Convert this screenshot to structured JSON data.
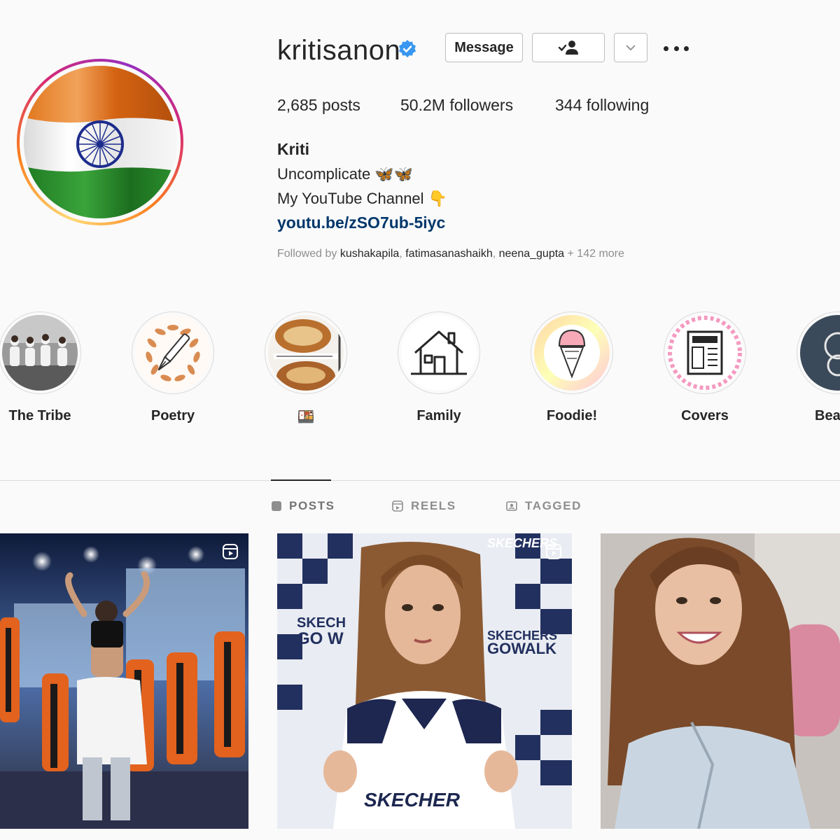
{
  "profile": {
    "username": "kritisanon",
    "verified": true,
    "message_button": "Message",
    "stats": {
      "posts": "2,685 posts",
      "followers": "50.2M followers",
      "following": "344 following"
    },
    "bio": {
      "name": "Kriti",
      "line1": "Uncomplicate 🦋🦋",
      "line2": "My YouTube Channel 👇",
      "link": "youtu.be/zSO7ub-5iyc"
    },
    "followed_by": {
      "prefix": "Followed by ",
      "names": [
        "kushakapila",
        "fatimasanashaikh",
        "neena_gupta"
      ],
      "more": " + 142 more"
    }
  },
  "highlights": [
    {
      "label": "The Tribe",
      "icon": "group-photo"
    },
    {
      "label": "Poetry",
      "icon": "fountain-pen-icon"
    },
    {
      "label": "🍱",
      "icon": "food-photo"
    },
    {
      "label": "Family",
      "icon": "house-icon"
    },
    {
      "label": "Foodie!",
      "icon": "ice-cream-icon"
    },
    {
      "label": "Covers",
      "icon": "magazine-icon"
    },
    {
      "label": "Bea",
      "icon": "mirror-icon"
    }
  ],
  "tabs": [
    {
      "label": "POSTS",
      "icon": "grid-icon",
      "active": true
    },
    {
      "label": "REELS",
      "icon": "reels-icon",
      "active": false
    },
    {
      "label": "TAGGED",
      "icon": "tag-icon",
      "active": false
    }
  ],
  "posts": [
    {
      "type": "reel",
      "subject": "stage dance performance"
    },
    {
      "type": "reel",
      "subject": "skechers promotion",
      "print": [
        "SKECHERS",
        "SKECH",
        "GO W",
        "SKECHERS",
        "GOWALK",
        "SKECHER"
      ]
    },
    {
      "type": "photo",
      "subject": "smiling portrait"
    }
  ],
  "colors": {
    "link": "#00376b",
    "verified": "#3897f0",
    "text": "#262626",
    "muted": "#8e8e8e"
  }
}
